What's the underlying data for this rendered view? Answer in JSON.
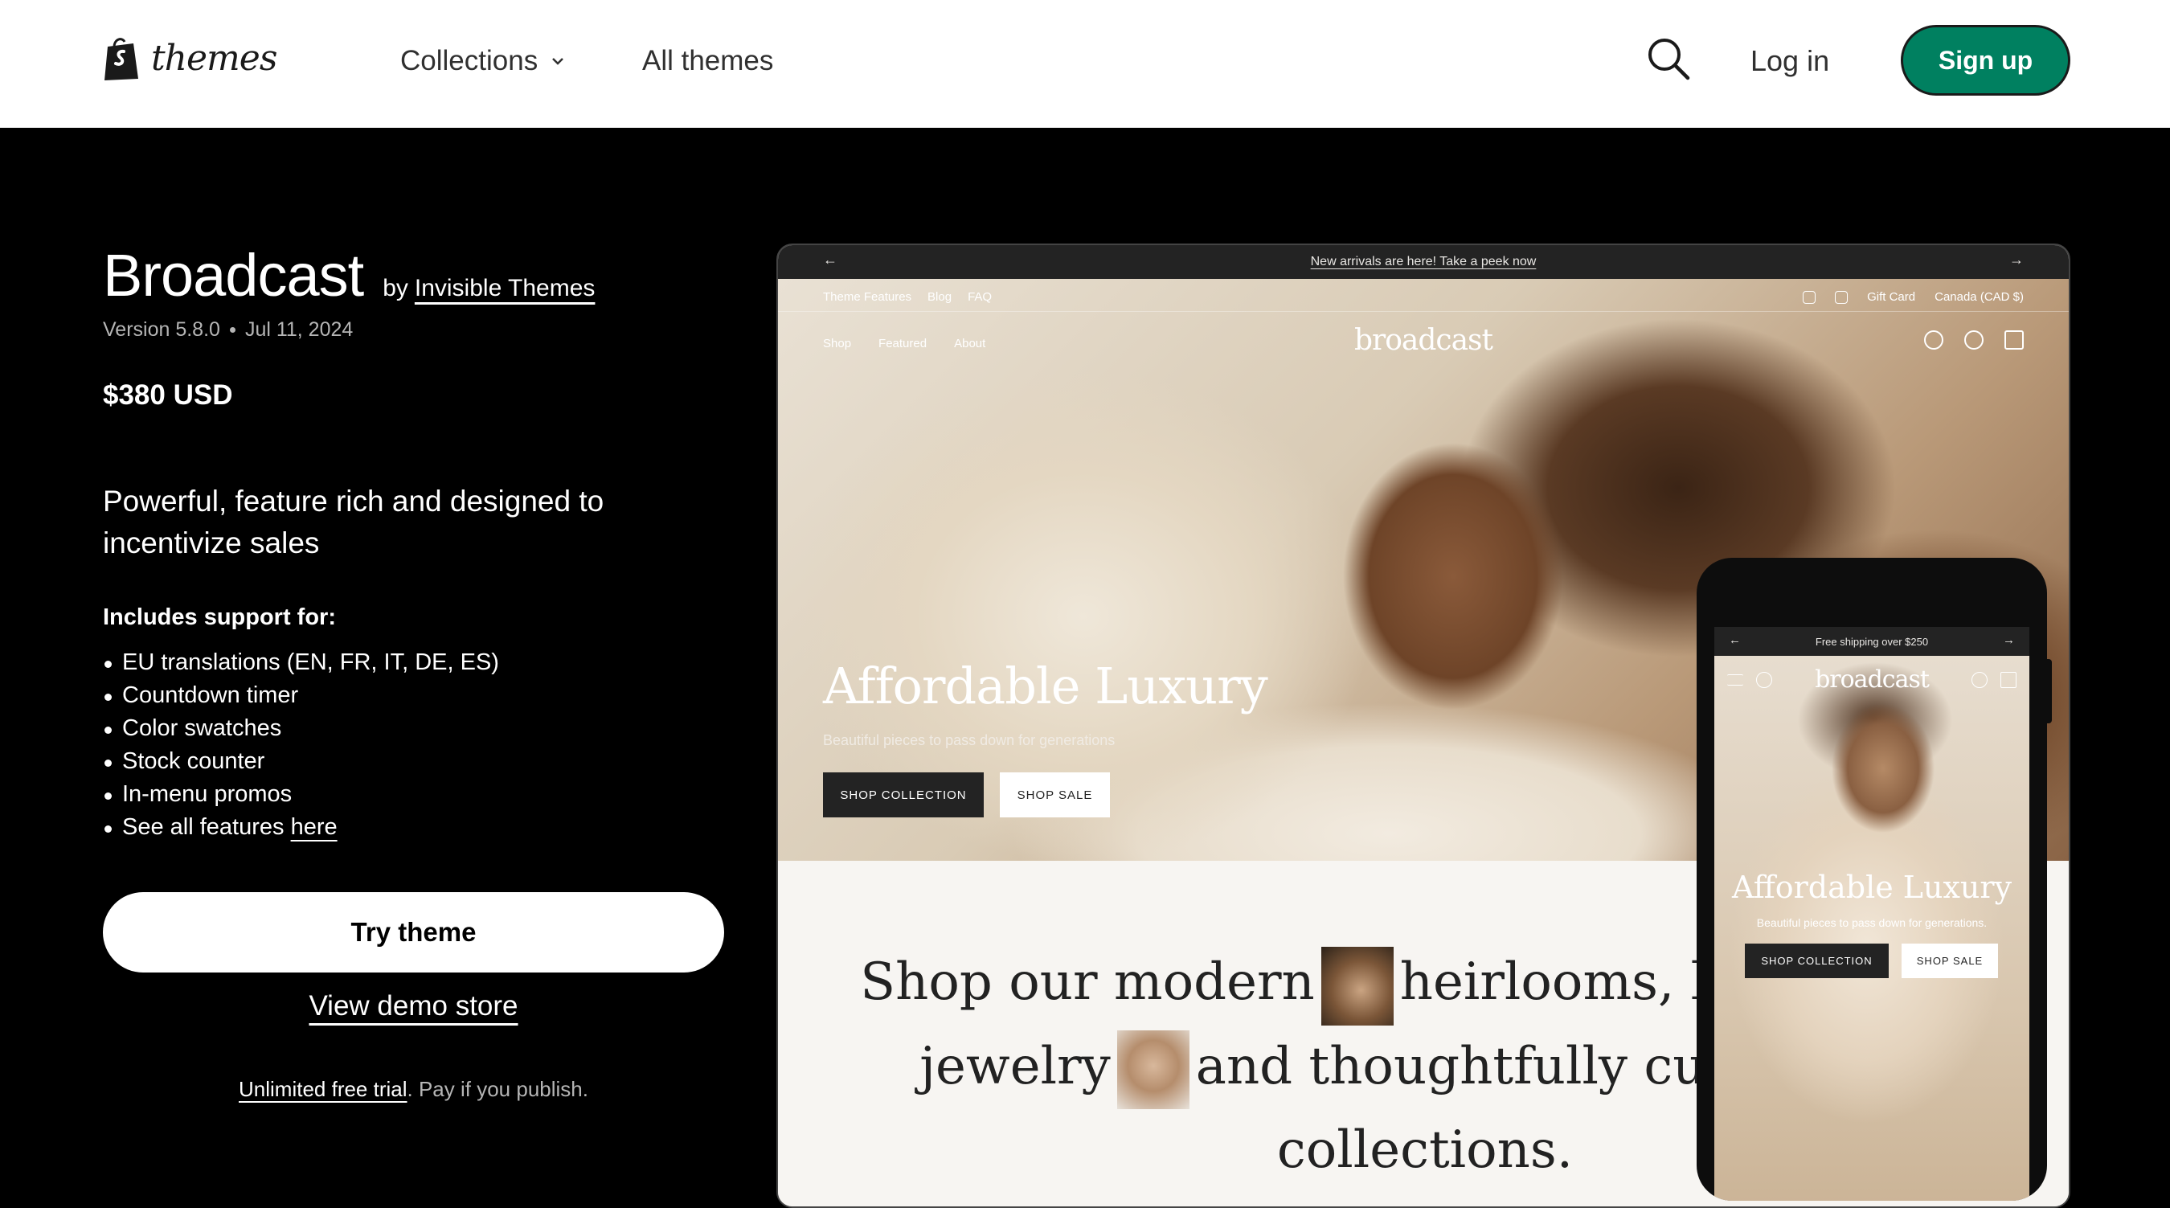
{
  "header": {
    "logo_text": "themes",
    "nav": {
      "collections": "Collections",
      "all_themes": "All themes"
    },
    "login": "Log in",
    "signup": "Sign up"
  },
  "theme": {
    "name": "Broadcast",
    "by": "by",
    "author": "Invisible Themes",
    "version": "Version 5.8.0",
    "date": "Jul 11, 2024",
    "price": "$380 USD",
    "tagline": "Powerful, feature rich and designed to incentivize sales",
    "support_title": "Includes support for:",
    "features": [
      "EU translations (EN, FR, IT, DE, ES)",
      "Countdown timer",
      "Color swatches",
      "Stock counter",
      "In-menu promos"
    ],
    "features_last_prefix": "See all features ",
    "features_last_link": "here"
  },
  "actions": {
    "try": "Try theme",
    "demo": "View demo store",
    "trial_link": "Unlimited free trial",
    "trial_rest": ". Pay if you publish."
  },
  "preview": {
    "announcement": "New arrivals are here! Take a peek now",
    "top_nav": [
      "Theme Features",
      "Blog",
      "FAQ"
    ],
    "top_right": {
      "gift": "Gift Card",
      "currency": "Canada (CAD $)"
    },
    "main_nav": [
      "Shop",
      "Featured",
      "About"
    ],
    "brand": "broadcast",
    "headline": "Affordable Luxury",
    "subhead": "Beautiful pieces to pass down for generations",
    "btn_collection": "SHOP COLLECTION",
    "btn_sale": "SHOP SALE",
    "shop_text": {
      "p1": "Shop our modern",
      "p2": "heirlooms, best selling",
      "p3": "jewelry",
      "p4": "and thoughtfully curated",
      "p5": "collections."
    }
  },
  "phone": {
    "announcement": "Free shipping over $250",
    "brand": "broadcast",
    "headline": "Affordable Luxury",
    "subhead": "Beautiful pieces to pass down for generations.",
    "btn_collection": "SHOP COLLECTION",
    "btn_sale": "SHOP SALE"
  },
  "colors": {
    "accent": "#008060",
    "page_bg": "#000000"
  }
}
